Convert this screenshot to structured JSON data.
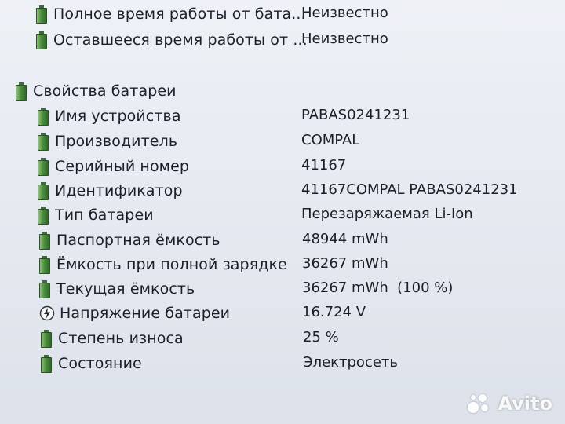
{
  "rows": [
    {
      "label": "Полное время работы от бата...",
      "value": "Неизвестно",
      "icon": "battery-icon"
    },
    {
      "label": "Оставшееся время работы от ...",
      "value": "Неизвестно",
      "icon": "battery-icon"
    },
    {
      "label": "Свойства батареи",
      "value": "",
      "icon": "battery-icon"
    },
    {
      "label": "Имя устройства",
      "value": "PABAS0241231",
      "icon": "battery-icon"
    },
    {
      "label": "Производитель",
      "value": "COMPAL",
      "icon": "battery-icon"
    },
    {
      "label": "Серийный номер",
      "value": "41167",
      "icon": "battery-icon"
    },
    {
      "label": "Идентификатор",
      "value": "41167COMPAL PABAS0241231",
      "icon": "battery-icon"
    },
    {
      "label": "Тип батареи",
      "value": "Перезаряжаемая Li-Ion",
      "icon": "battery-icon"
    },
    {
      "label": "Паспортная ёмкость",
      "value": "48944 mWh",
      "icon": "battery-icon"
    },
    {
      "label": "Ёмкость при полной зарядке",
      "value": "36267 mWh",
      "icon": "battery-icon"
    },
    {
      "label": "Текущая ёмкость",
      "value": "36267 mWh  (100 %)",
      "icon": "battery-icon"
    },
    {
      "label": "Напряжение батареи",
      "value": "16.724 V",
      "icon": "voltage-icon"
    },
    {
      "label": "Степень износа",
      "value": "25 %",
      "icon": "battery-icon"
    },
    {
      "label": "Состояние",
      "value": "Электросеть",
      "icon": "battery-icon"
    }
  ],
  "watermark": {
    "text": "Avito"
  },
  "colors": {
    "battery_green": "#4d8d3e",
    "background": "#e8ecf2",
    "text": "#1a1f2a"
  }
}
